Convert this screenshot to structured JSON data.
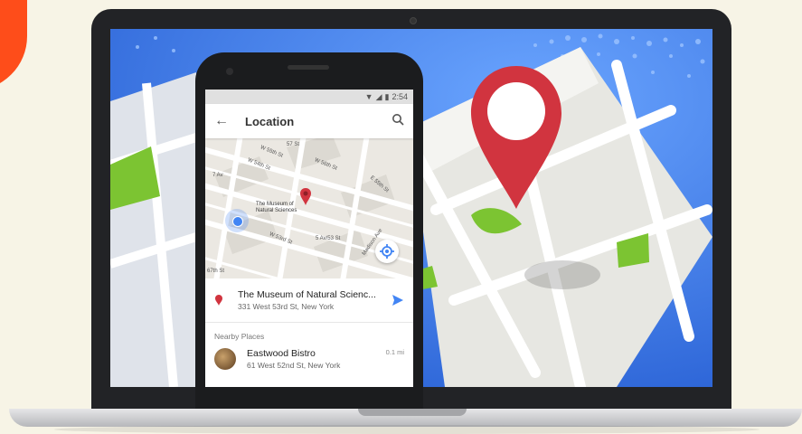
{
  "status_bar": {
    "time": "2:54"
  },
  "app_bar": {
    "title": "Location",
    "back_icon": "arrow-left-icon",
    "search_icon": "search-icon"
  },
  "map": {
    "street_labels": [
      "57 St",
      "W 55th St",
      "W 54th St",
      "W 56th St",
      "7 Av",
      "5 Av/53 St",
      "W 53rd St",
      "W 51st St",
      "Madison Ave",
      "E 55th St",
      "E 54th St",
      "67th St"
    ],
    "poi_label": "The Museum of\nNatural Sciences"
  },
  "selected_place": {
    "name": "The Museum of Natural Scienc...",
    "address": "331 West 53rd St, New York"
  },
  "nearby": {
    "header": "Nearby Places",
    "items": [
      {
        "name": "Eastwood Bistro",
        "address": "61 West 52nd St, New York",
        "distance": "0.1 mi"
      }
    ]
  },
  "colors": {
    "screen_bg": "#2f6fe4",
    "pin": "#d1343f",
    "map_green": "#7cc432",
    "accent_blue": "#4285f4",
    "orange": "#fe4d1a"
  }
}
